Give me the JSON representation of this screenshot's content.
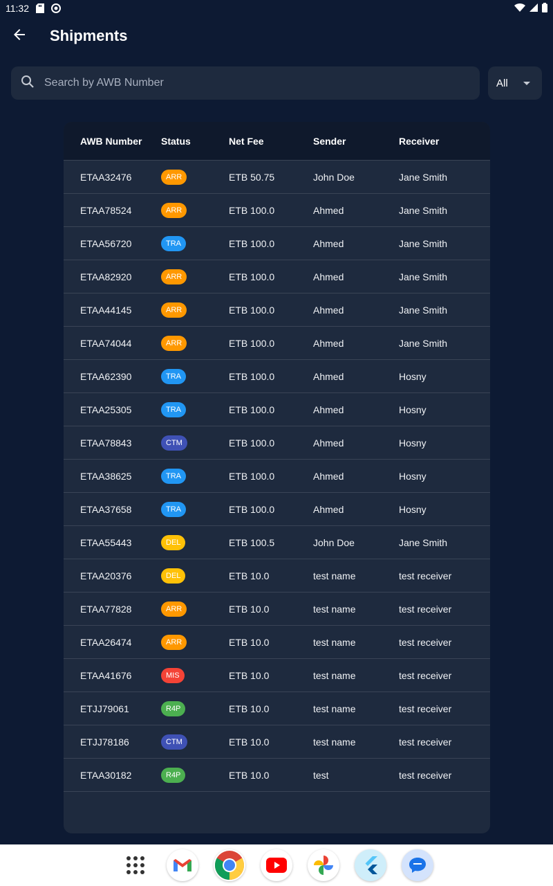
{
  "status_bar": {
    "time": "11:32"
  },
  "app_bar": {
    "title": "Shipments"
  },
  "search": {
    "placeholder": "Search by AWB Number",
    "filter_value": "All"
  },
  "table": {
    "headers": [
      "AWB Number",
      "Status",
      "Net Fee",
      "Sender",
      "Receiver"
    ],
    "rows": [
      {
        "awb": "ETAA32476",
        "status": "ARR",
        "fee": "ETB 50.75",
        "sender": "John Doe",
        "receiver": "Jane Smith"
      },
      {
        "awb": "ETAA78524",
        "status": "ARR",
        "fee": "ETB 100.0",
        "sender": "Ahmed",
        "receiver": "Jane Smith"
      },
      {
        "awb": "ETAA56720",
        "status": "TRA",
        "fee": "ETB 100.0",
        "sender": "Ahmed",
        "receiver": "Jane Smith"
      },
      {
        "awb": "ETAA82920",
        "status": "ARR",
        "fee": "ETB 100.0",
        "sender": "Ahmed",
        "receiver": "Jane Smith"
      },
      {
        "awb": "ETAA44145",
        "status": "ARR",
        "fee": "ETB 100.0",
        "sender": "Ahmed",
        "receiver": "Jane Smith"
      },
      {
        "awb": "ETAA74044",
        "status": "ARR",
        "fee": "ETB 100.0",
        "sender": "Ahmed",
        "receiver": "Jane Smith"
      },
      {
        "awb": "ETAA62390",
        "status": "TRA",
        "fee": "ETB 100.0",
        "sender": "Ahmed",
        "receiver": "Hosny"
      },
      {
        "awb": "ETAA25305",
        "status": "TRA",
        "fee": "ETB 100.0",
        "sender": "Ahmed",
        "receiver": "Hosny"
      },
      {
        "awb": "ETAA78843",
        "status": "CTM",
        "fee": "ETB 100.0",
        "sender": "Ahmed",
        "receiver": "Hosny"
      },
      {
        "awb": "ETAA38625",
        "status": "TRA",
        "fee": "ETB 100.0",
        "sender": "Ahmed",
        "receiver": "Hosny"
      },
      {
        "awb": "ETAA37658",
        "status": "TRA",
        "fee": "ETB 100.0",
        "sender": "Ahmed",
        "receiver": "Hosny"
      },
      {
        "awb": "ETAA55443",
        "status": "DEL",
        "fee": "ETB 100.5",
        "sender": "John Doe",
        "receiver": "Jane Smith"
      },
      {
        "awb": "ETAA20376",
        "status": "DEL",
        "fee": "ETB 10.0",
        "sender": "test name",
        "receiver": "test receiver"
      },
      {
        "awb": "ETAA77828",
        "status": "ARR",
        "fee": "ETB 10.0",
        "sender": "test name",
        "receiver": "test receiver"
      },
      {
        "awb": "ETAA26474",
        "status": "ARR",
        "fee": "ETB 10.0",
        "sender": "test name",
        "receiver": "test receiver"
      },
      {
        "awb": "ETAA41676",
        "status": "MIS",
        "fee": "ETB 10.0",
        "sender": "test name",
        "receiver": "test receiver"
      },
      {
        "awb": "ETJJ79061",
        "status": "R4P",
        "fee": "ETB 10.0",
        "sender": "test name",
        "receiver": "test receiver"
      },
      {
        "awb": "ETJJ78186",
        "status": "CTM",
        "fee": "ETB 10.0",
        "sender": "test name",
        "receiver": "test receiver"
      },
      {
        "awb": "ETAA30182",
        "status": "R4P",
        "fee": "ETB 10.0",
        "sender": "test",
        "receiver": "test receiver"
      }
    ]
  },
  "status_colors": {
    "ARR": "#ff9800",
    "TRA": "#2196f3",
    "CTM": "#3f51b5",
    "DEL": "#ffc107",
    "MIS": "#f44336",
    "R4P": "#4caf50"
  },
  "dock": {
    "apps": [
      "app-drawer-icon",
      "gmail-icon",
      "chrome-icon",
      "youtube-icon",
      "photos-icon",
      "flutter-icon",
      "messages-icon"
    ]
  }
}
